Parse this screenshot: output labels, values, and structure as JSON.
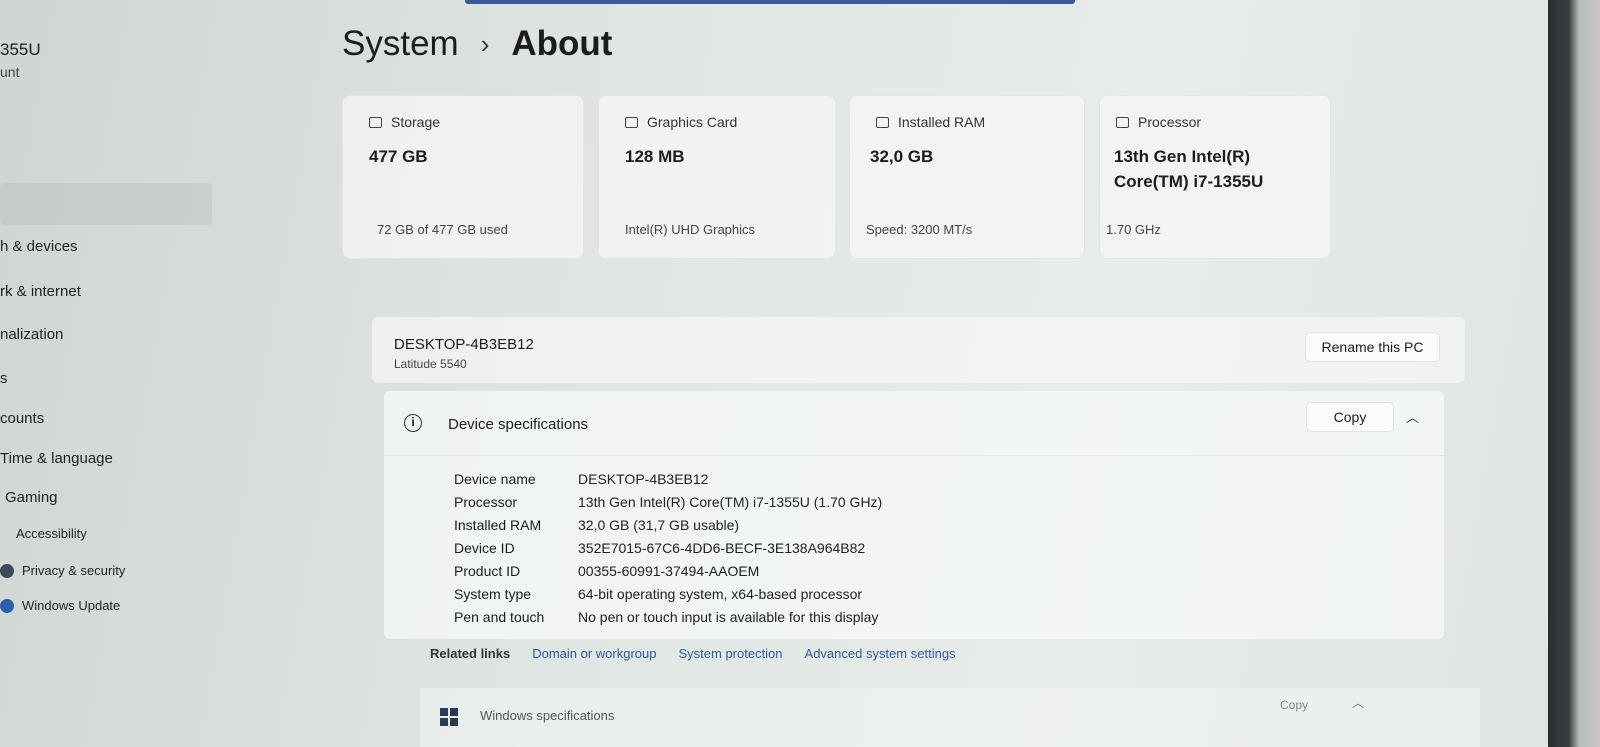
{
  "sidebar": {
    "user_name": "355U",
    "user_sub": "unt",
    "items": [
      {
        "label": "h & devices"
      },
      {
        "label": "rk & internet"
      },
      {
        "label": "nalization"
      },
      {
        "label": "s"
      },
      {
        "label": "counts"
      },
      {
        "label": "Time & language"
      },
      {
        "label": "Gaming"
      },
      {
        "label": "Accessibility"
      },
      {
        "label": "Privacy & security"
      },
      {
        "label": "Windows Update"
      }
    ]
  },
  "header": {
    "parent": "System",
    "separator": "›",
    "current": "About"
  },
  "cards": [
    {
      "title": "Storage",
      "icon": "storage-icon",
      "value": "477 GB",
      "sub": "72 GB of 477 GB used"
    },
    {
      "title": "Graphics Card",
      "icon": "graphics-card-icon",
      "value": "128 MB",
      "sub": "Intel(R) UHD Graphics"
    },
    {
      "title": "Installed RAM",
      "icon": "ram-icon",
      "value": "32,0 GB",
      "sub": "Speed: 3200 MT/s"
    },
    {
      "title": "Processor",
      "icon": "processor-icon",
      "value": "13th Gen Intel(R) Core(TM) i7-1355U",
      "sub": "1.70 GHz"
    }
  ],
  "pc": {
    "name": "DESKTOP-4B3EB12",
    "model": "Latitude 5540",
    "rename_label": "Rename this PC"
  },
  "device_specs": {
    "title": "Device specifications",
    "copy_label": "Copy",
    "rows": [
      {
        "label": "Device name",
        "value": "DESKTOP-4B3EB12"
      },
      {
        "label": "Processor",
        "value": "13th Gen Intel(R) Core(TM) i7-1355U (1.70 GHz)"
      },
      {
        "label": "Installed RAM",
        "value": "32,0 GB (31,7 GB usable)"
      },
      {
        "label": "Device ID",
        "value": "352E7015-67C6-4DD6-BECF-3E138A964B82"
      },
      {
        "label": "Product ID",
        "value": "00355-60991-37494-AAOEM"
      },
      {
        "label": "System type",
        "value": "64-bit operating system, x64-based processor"
      },
      {
        "label": "Pen and touch",
        "value": "No pen or touch input is available for this display"
      }
    ]
  },
  "related_links": {
    "label": "Related links",
    "links": [
      "Domain or workgroup",
      "System protection",
      "Advanced system settings"
    ]
  },
  "windows_specs": {
    "title": "Windows specifications",
    "copy_label": "Copy"
  }
}
